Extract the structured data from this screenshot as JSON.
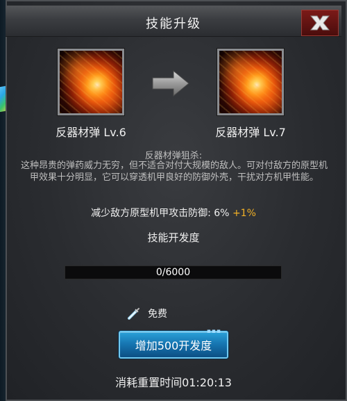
{
  "header": {
    "title": "技能升级"
  },
  "close_icon": "close-icon",
  "skill_from": {
    "name": "反器材弹 Lv.6"
  },
  "skill_to": {
    "name": "反器材弹 Lv.7"
  },
  "description": {
    "title": "反器材弹狙杀:",
    "body": "这种昂贵的弹药威力无穷，但不适合对付大规模的敌人。可对付敌方的原型机甲效果十分明显，它可以穿透机甲良好的防御外壳，干扰对方机甲性能。"
  },
  "effect": {
    "label": "减少敌方原型机甲攻击防御:",
    "value": "6%",
    "bonus": "+1%"
  },
  "development": {
    "label": "技能开发度",
    "progress_text": "0/6000",
    "progress_fraction": 0
  },
  "cost": {
    "label": "免费"
  },
  "action": {
    "label": "增加500开发度"
  },
  "reset": {
    "label": "消耗重置时间01:20:13"
  },
  "colors": {
    "bonus": "#f2b126",
    "button": "#1674b0",
    "close": "#7b1a18"
  }
}
